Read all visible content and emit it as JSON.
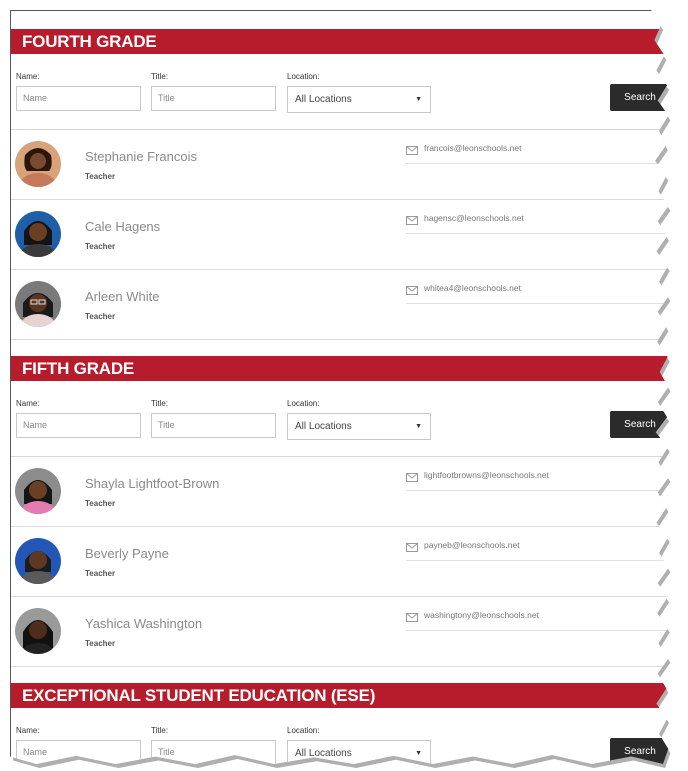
{
  "filters_common": {
    "name_label": "Name:",
    "title_label": "Title:",
    "location_label": "Location:",
    "name_placeholder": "Name",
    "title_placeholder": "Title",
    "location_value": "All Locations",
    "search_label": "Search"
  },
  "colors": {
    "banner": "#b71c2c",
    "search_button": "#2b2b2b"
  },
  "sections": [
    {
      "heading": "FOURTH GRADE",
      "people": [
        {
          "name": "Stephanie Francois",
          "role": "Teacher",
          "email": "francois@leonschools.net",
          "icon": "mail-icon"
        },
        {
          "name": "Cale Hagens",
          "role": "Teacher",
          "email": "hagensc@leonschools.net",
          "icon": "mail-icon"
        },
        {
          "name": "Arleen White",
          "role": "Teacher",
          "email": "whitea4@leonschools.net",
          "icon": "mail-icon"
        }
      ]
    },
    {
      "heading": "FIFTH GRADE",
      "people": [
        {
          "name": "Shayla Lightfoot-Brown",
          "role": "Teacher",
          "email": "lightfootbrowns@leonschools.net",
          "icon": "mail-icon"
        },
        {
          "name": "Beverly Payne",
          "role": "Teacher",
          "email": "payneb@leonschools.net",
          "icon": "mail-icon"
        },
        {
          "name": "Yashica Washington",
          "role": "Teacher",
          "email": "washingtony@leonschools.net",
          "icon": "mail-icon"
        }
      ]
    },
    {
      "heading": "EXCEPTIONAL STUDENT EDUCATION (ESE)",
      "people": []
    }
  ]
}
